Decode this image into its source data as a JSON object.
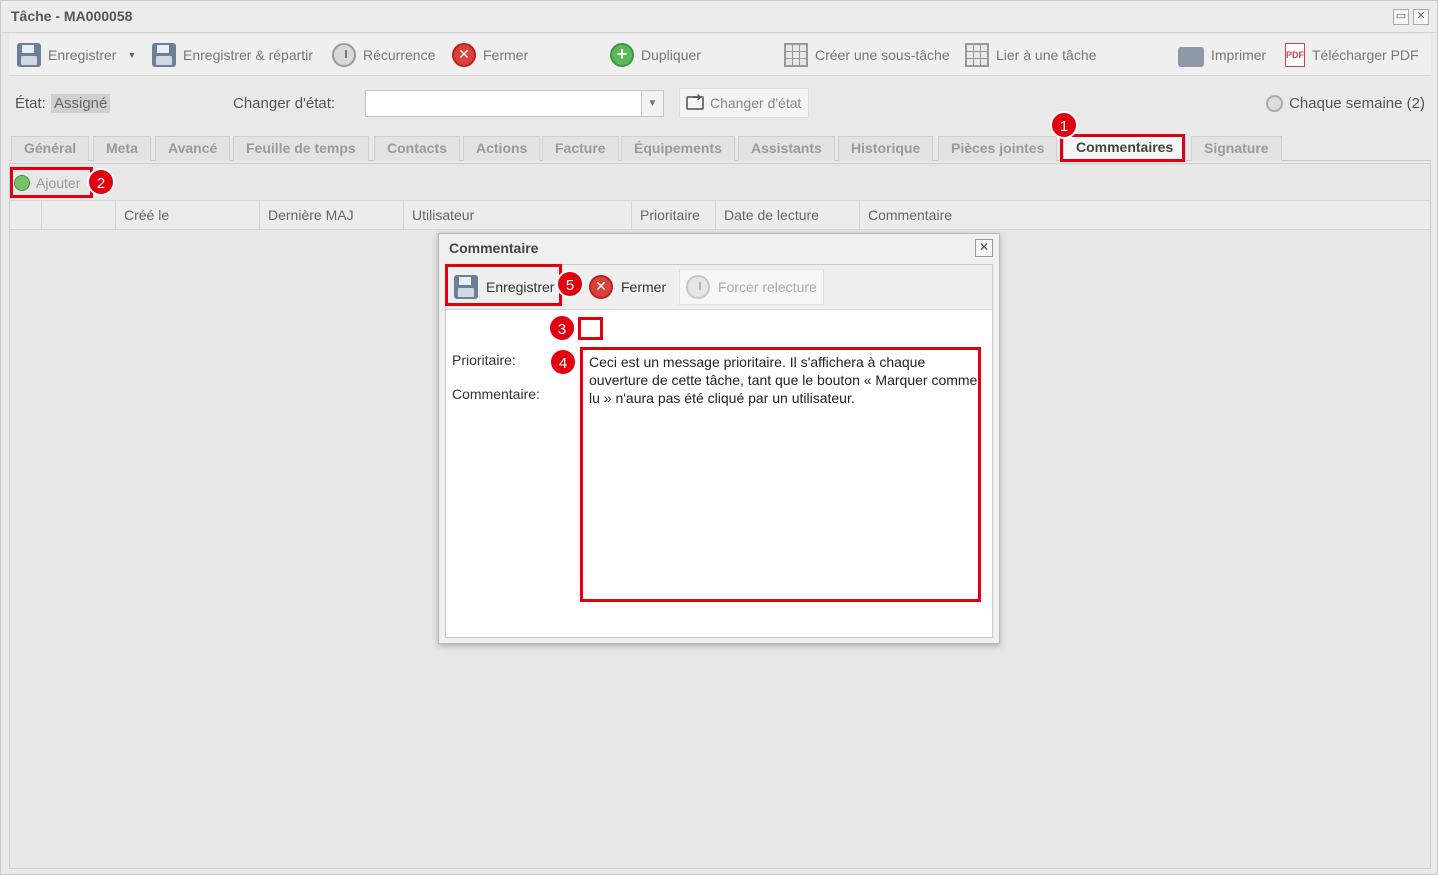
{
  "window": {
    "title": "Tâche - MA000058"
  },
  "toolbar": {
    "save": "Enregistrer",
    "save_distribute": "Enregistrer & répartir",
    "recurrence": "Récurrence",
    "close": "Fermer",
    "duplicate": "Dupliquer",
    "create_subtask": "Créer une sous-tâche",
    "link_task": "Lier à une tâche",
    "print": "Imprimer",
    "download_pdf": "Télécharger PDF"
  },
  "status": {
    "state_label": "État:",
    "state_value": "Assigné",
    "change_label": "Changer d'état:",
    "change_select_value": "",
    "change_button": "Changer d'état",
    "recurrence_info": "Chaque semaine (2)"
  },
  "tabs": [
    {
      "label": "Général"
    },
    {
      "label": "Meta"
    },
    {
      "label": "Avancé"
    },
    {
      "label": "Feuille de temps"
    },
    {
      "label": "Contacts"
    },
    {
      "label": "Actions"
    },
    {
      "label": "Facture"
    },
    {
      "label": "Équipements"
    },
    {
      "label": "Assistants"
    },
    {
      "label": "Historique"
    },
    {
      "label": "Pièces jointes"
    },
    {
      "label": "Commentaires"
    },
    {
      "label": "Signature"
    }
  ],
  "comments": {
    "add_button": "Ajouter",
    "columns": [
      "Créé le",
      "Dernière MAJ",
      "Utilisateur",
      "Prioritaire",
      "Date de lecture",
      "Commentaire"
    ]
  },
  "dialog": {
    "title": "Commentaire",
    "save": "Enregistrer",
    "close": "Fermer",
    "force_reread": "Forcer relecture",
    "priority_label": "Prioritaire:",
    "priority_checked": true,
    "comment_label": "Commentaire:",
    "comment_value": "Ceci est un message prioritaire. Il s'affichera à chaque ouverture de cette tâche, tant que le bouton « Marquer comme lu » n'aura pas été cliqué par un utilisateur."
  },
  "callouts": [
    "1",
    "2",
    "3",
    "4",
    "5"
  ],
  "colors": {
    "highlight": "#e00010",
    "active_tab_text": "#444444"
  }
}
